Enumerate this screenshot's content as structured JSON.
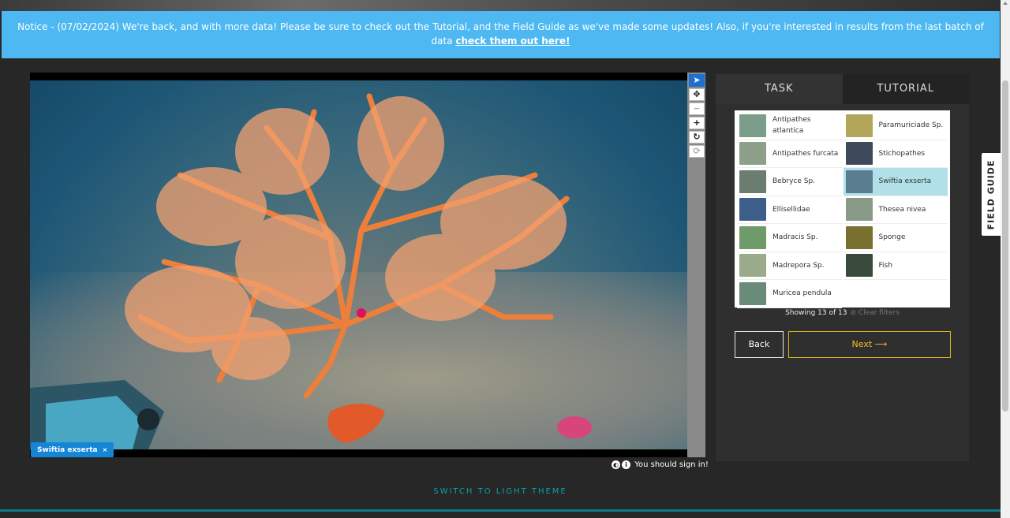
{
  "notice": {
    "text": "Notice - (07/02/2024) We're back, and with more data! Please be sure to check out the Tutorial, and the Field Guide as we've made some updates! Also, if you're interested in results from the last batch of data ",
    "link_text": "check them out here!"
  },
  "viewer": {
    "annotation_tag": "Swiftia exserta",
    "tag_close": "×"
  },
  "toolbar": {
    "tools": [
      "pointer-icon",
      "pan-icon",
      "zoom-out-icon",
      "zoom-in-icon",
      "rotate-icon",
      "reset-icon"
    ]
  },
  "signin": {
    "text": "You should sign in!"
  },
  "panel": {
    "tabs": [
      "TASK",
      "TUTORIAL"
    ],
    "choices": [
      {
        "label": "Antipathes atlantica",
        "color": "#7a9e8a"
      },
      {
        "label": "Paramuriciade Sp.",
        "color": "#b3a65a"
      },
      {
        "label": "Antipathes furcata",
        "color": "#8ea08a"
      },
      {
        "label": "Stichopathes",
        "color": "#3c4a5a"
      },
      {
        "label": "Bebryce Sp.",
        "color": "#6a7d6e"
      },
      {
        "label": "Swiftia exserta",
        "color": "#5a7d8f"
      },
      {
        "label": "Ellisellidae",
        "color": "#3e5e8a"
      },
      {
        "label": "Thesea nivea",
        "color": "#8a9a88"
      },
      {
        "label": "Madracis Sp.",
        "color": "#6f9a6a"
      },
      {
        "label": "Sponge",
        "color": "#7a7030"
      },
      {
        "label": "Madrepora Sp.",
        "color": "#9aaa8a"
      },
      {
        "label": "Fish",
        "color": "#3a4a3a"
      },
      {
        "label": "Muricea pendula",
        "color": "#6a8a7a"
      }
    ],
    "selected": "Swiftia exserta",
    "showing": "Showing 13 of 13",
    "clear_filters": "⊘ Clear filters",
    "back": "Back",
    "next": "Next ⟶"
  },
  "field_guide": "FIELD GUIDE",
  "theme_switch": "SWITCH TO LIGHT THEME"
}
